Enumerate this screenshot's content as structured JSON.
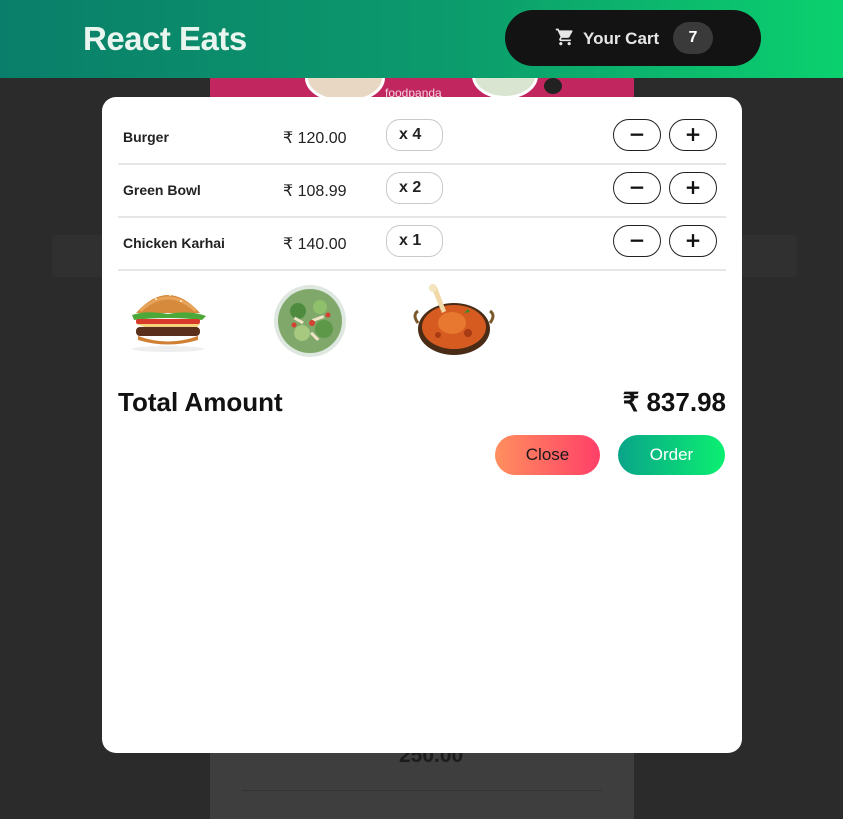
{
  "app": {
    "brand": "React Eats",
    "cart_label": "Your Cart",
    "cart_count": "7"
  },
  "banner": {
    "text": "foodpanda"
  },
  "background": {
    "price": "250.00"
  },
  "cart": {
    "items": [
      {
        "name": "Burger",
        "price": "₹ 120.00",
        "qty": "x 4"
      },
      {
        "name": "Green Bowl",
        "price": "₹ 108.99",
        "qty": "x 2"
      },
      {
        "name": "Chicken Karhai",
        "price": "₹ 140.00",
        "qty": "x 1"
      }
    ],
    "minus_label": "−",
    "plus_label": "+",
    "images": [
      "burger-image",
      "green-bowl-image",
      "chicken-karhai-image"
    ],
    "total_label": "Total Amount",
    "total_value": "₹ 837.98",
    "close_label": "Close",
    "order_label": "Order"
  },
  "colors": {
    "header_start": "#0a7e6a",
    "header_end": "#0bd16e",
    "close_start": "#ff8f5e",
    "close_end": "#ff3f68",
    "order_start": "#0aa489",
    "order_end": "#0bef71"
  }
}
